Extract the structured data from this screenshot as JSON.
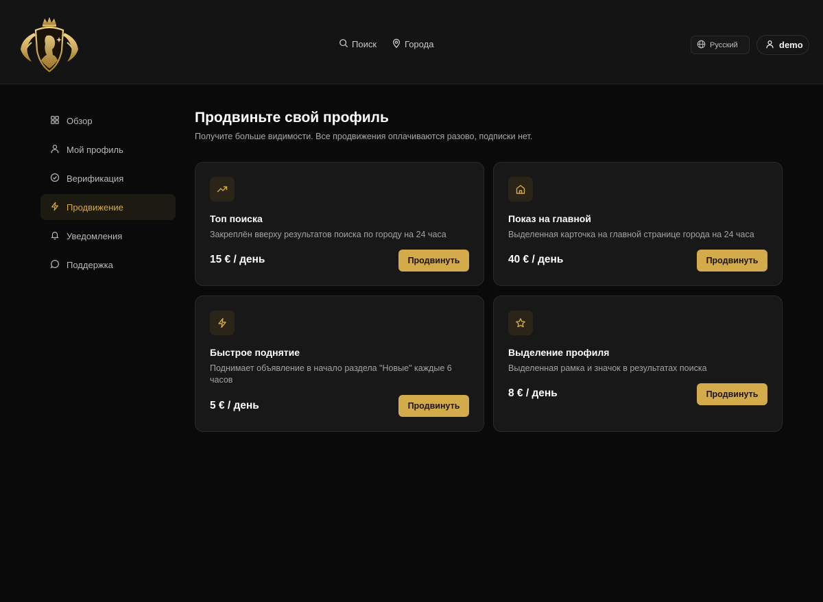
{
  "header": {
    "nav": [
      {
        "label": "Поиск",
        "icon": "search-icon"
      },
      {
        "label": "Города",
        "icon": "map-pin-icon"
      }
    ],
    "language": "Русский",
    "username": "demo"
  },
  "sidebar": {
    "items": [
      {
        "label": "Обзор",
        "icon": "grid-icon",
        "active": false
      },
      {
        "label": "Мой профиль",
        "icon": "user-icon",
        "active": false
      },
      {
        "label": "Верификация",
        "icon": "check-circle-icon",
        "active": false
      },
      {
        "label": "Продвижение",
        "icon": "lightning-icon",
        "active": true
      },
      {
        "label": "Уведомления",
        "icon": "bell-icon",
        "active": false
      },
      {
        "label": "Поддержка",
        "icon": "chat-icon",
        "active": false
      }
    ]
  },
  "main": {
    "title": "Продвиньте свой профиль",
    "subtitle": "Получите больше видимости. Все продвижения оплачиваются разово, подписки нет.",
    "cards": [
      {
        "icon": "trending-up-icon",
        "title": "Топ поиска",
        "description": "Закреплён вверху результатов поиска по городу на 24 часа",
        "price": "15 € / день",
        "button": "Продвинуть"
      },
      {
        "icon": "home-icon",
        "title": "Показ на главной",
        "description": "Выделенная карточка на главной странице города на 24 часа",
        "price": "40 € / день",
        "button": "Продвинуть"
      },
      {
        "icon": "lightning-icon",
        "title": "Быстрое поднятие",
        "description": "Поднимает объявление в начало раздела \"Новые\" каждые 6 часов",
        "price": "5 € / день",
        "button": "Продвинуть"
      },
      {
        "icon": "star-icon",
        "title": "Выделение профиля",
        "description": "Выделенная рамка и значок в результатах поиска",
        "price": "8 € / день",
        "button": "Продвинуть"
      }
    ]
  },
  "colors": {
    "accent": "#d4ab4a",
    "background": "#0a0a0a",
    "card": "#181818"
  }
}
